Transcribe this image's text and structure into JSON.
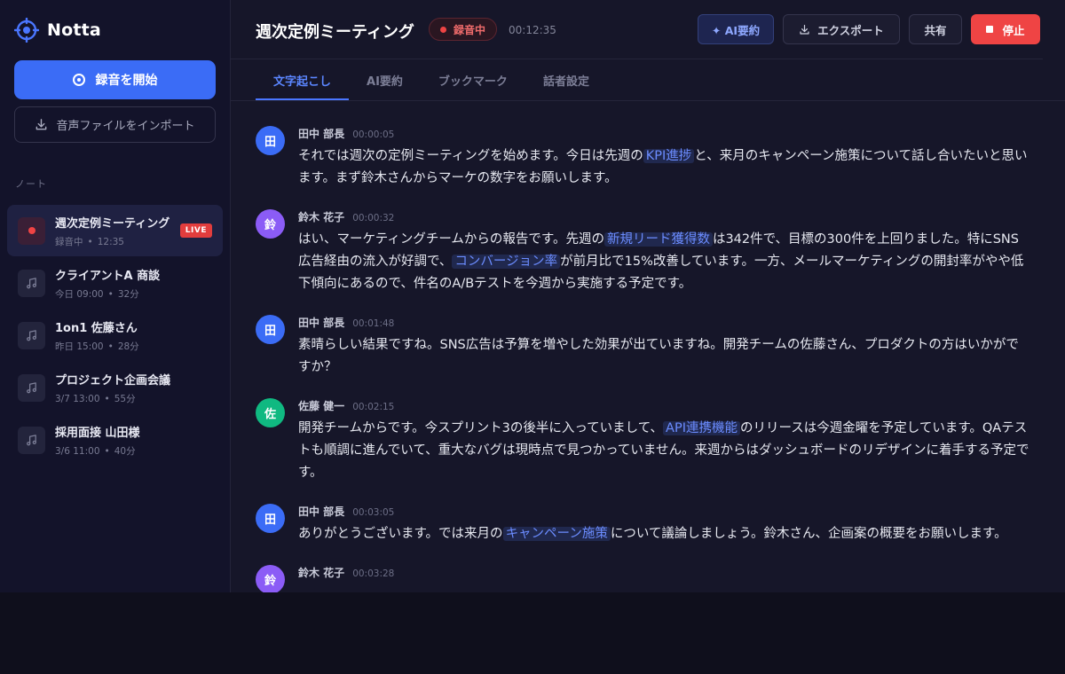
{
  "app": {
    "brand": "Notta"
  },
  "sidebar": {
    "record_label": "録音を開始",
    "import_label": "音声ファイルをインポート",
    "section_label": "ノート",
    "notes": [
      {
        "title": "週次定例ミーティング",
        "status": "録音中",
        "time": "12:35",
        "badge": "LIVE",
        "active": true
      },
      {
        "title": "クライアントA 商談",
        "date": "今日 09:00",
        "duration": "32分"
      },
      {
        "title": "1on1 佐藤さん",
        "date": "昨日 15:00",
        "duration": "28分"
      },
      {
        "title": "プロジェクト企画会議",
        "date": "3/7 13:00",
        "duration": "55分"
      },
      {
        "title": "採用面接 山田様",
        "date": "3/6 11:00",
        "duration": "40分"
      }
    ]
  },
  "header": {
    "title": "週次定例ミーティング",
    "rec_label": "録音中",
    "timer": "00:12:35",
    "ai_label": "✦ AI要約",
    "export_label": "エクスポート",
    "share_label": "共有",
    "stop_label": "停止"
  },
  "tabs": [
    {
      "label": "文字起こし",
      "active": true
    },
    {
      "label": "AI要約"
    },
    {
      "label": "ブックマーク"
    },
    {
      "label": "話者設定"
    }
  ],
  "colors": {
    "accent": "#3b6cf6",
    "danger": "#ef4444",
    "avatar_tanaka": "#3b6cf6",
    "avatar_suzuki": "#8b5cf6",
    "avatar_sato": "#10b981"
  },
  "transcript": [
    {
      "avatar": "田",
      "speaker": "田中 部長",
      "time": "00:00:05",
      "parts": [
        "それでは週次の定例ミーティングを始めます。今日は先週の",
        "KPI進捗",
        "と、来月のキャンペーン施策について話し合いたいと思います。まず鈴木さんからマーケの数字をお願いします。"
      ]
    },
    {
      "avatar": "鈴",
      "speaker": "鈴木 花子",
      "time": "00:00:32",
      "parts": [
        "はい、マーケティングチームからの報告です。先週の",
        "新規リード獲得数",
        "は342件で、目標の300件を上回りました。特にSNS広告経由の流入が好調で、",
        "コンバージョン率",
        "が前月比で15%改善しています。一方、メールマーケティングの開封率がやや低下傾向にあるので、件名のA/Bテストを今週から実施する予定です。"
      ]
    },
    {
      "avatar": "田",
      "speaker": "田中 部長",
      "time": "00:01:48",
      "parts": [
        "素晴らしい結果ですね。SNS広告は予算を増やした効果が出ていますね。開発チームの佐藤さん、プロダクトの方はいかがですか？"
      ]
    },
    {
      "avatar": "佐",
      "speaker": "佐藤 健一",
      "time": "00:02:15",
      "parts": [
        "開発チームからです。今スプリント3の後半に入っていまして、",
        "API連携機能",
        "のリリースは今週金曜を予定しています。QAテストも順調に進んでいて、重大なバグは現時点で見つかっていません。来週からはダッシュボードのリデザインに着手する予定です。"
      ]
    },
    {
      "avatar": "田",
      "speaker": "田中 部長",
      "time": "00:03:05",
      "parts": [
        "ありがとうございます。では来月の",
        "キャンペーン施策",
        "について議論しましょう。鈴木さん、企画案の概要をお願いします。"
      ]
    },
    {
      "avatar": "鈴",
      "speaker": "鈴木 花子",
      "time": "00:03:28",
      "parts": [
        ""
      ]
    }
  ]
}
